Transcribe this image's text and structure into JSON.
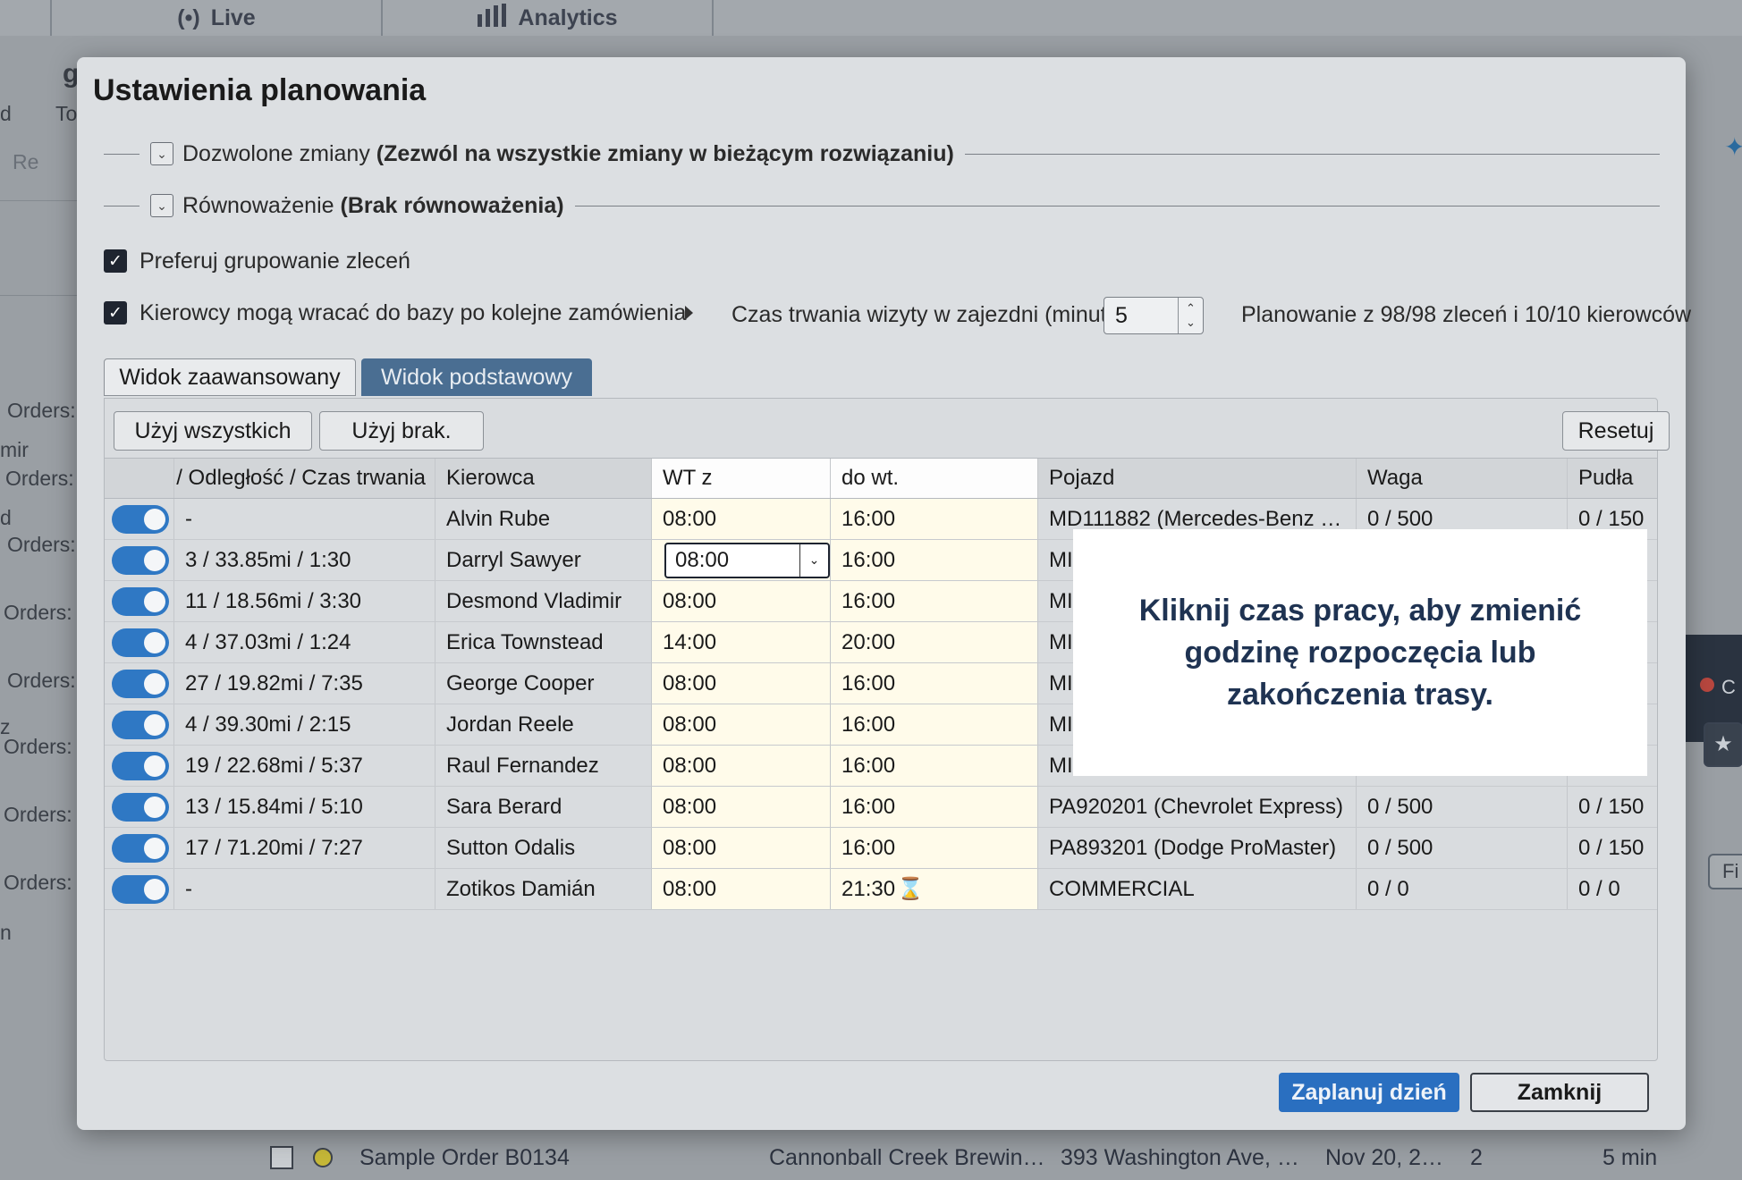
{
  "background": {
    "tabs": [
      {
        "icon": "broadcast-icon",
        "label": "Live"
      },
      {
        "icon": "bar-chart-icon",
        "label": "Analytics"
      }
    ],
    "left_fragments": [
      "g",
      "d",
      "To",
      "Re",
      "Orders:",
      "mir",
      "Orders:",
      "d",
      "Orders:",
      "Orders:",
      "Orders:",
      "z",
      "Orders:",
      "Orders:",
      "Orders:",
      "n"
    ],
    "right_fragments": {
      "c_label": "C",
      "fi_label": "Fi"
    },
    "order_row": {
      "name": "Sample Order B0134",
      "customer": "Cannonball Creek Brewin…",
      "address": "393 Washington Ave, …",
      "date": "Nov 20, 2…",
      "count": "2",
      "duration": "5 min"
    }
  },
  "modal": {
    "title": "Ustawienia planowania",
    "allowed_changes": {
      "label": "Dozwolone zmiany",
      "value": "(Zezwól na wszystkie zmiany w bieżącym rozwiązaniu)"
    },
    "balancing": {
      "label": "Równoważenie",
      "value": "(Brak równoważenia)"
    },
    "prefer_grouping": {
      "label": "Preferuj grupowanie zleceń",
      "checked": true
    },
    "return_to_depot": {
      "label": "Kierowcy mogą wracać do bazy po kolejne zamówienia",
      "checked": true
    },
    "depot_visit": {
      "label": "Czas trwania wizyty w zajezdni (minuty):",
      "value": "5"
    },
    "planning_summary": "Planowanie z 98/98 zleceń i 10/10 kierowców",
    "views": {
      "advanced": "Widok zaawansowany",
      "basic": "Widok podstawowy"
    },
    "toolbar": {
      "use_all": "Użyj wszystkich",
      "use_none": "Użyj brak.",
      "reset": "Resetuj"
    },
    "columns": {
      "distance": "# / Odległość / Czas trwania",
      "driver": "Kierowca",
      "from": "WT z",
      "to": "do wt.",
      "vehicle": "Pojazd",
      "weight": "Waga",
      "boxes": "Pudła"
    },
    "rows": [
      {
        "enabled": true,
        "distance": "-",
        "driver": "Alvin Rube",
        "from": "08:00",
        "to": "16:00",
        "vehicle": "MD111882 (Mercedes-Benz …",
        "weight": "0 / 500",
        "boxes": "0 / 150"
      },
      {
        "enabled": true,
        "distance": "3 / 33.85mi / 1:30",
        "driver": "Darryl Sawyer",
        "from": "08:00",
        "to": "16:00",
        "vehicle": "MI",
        "weight": "",
        "boxes": ""
      },
      {
        "enabled": true,
        "distance": "11 / 18.56mi / 3:30",
        "driver": "Desmond Vladimir",
        "from": "08:00",
        "to": "16:00",
        "vehicle": "MI",
        "weight": "",
        "boxes": ""
      },
      {
        "enabled": true,
        "distance": "4 / 37.03mi / 1:24",
        "driver": "Erica Townstead",
        "from": "14:00",
        "to": "20:00",
        "vehicle": "MI",
        "weight": "",
        "boxes": ""
      },
      {
        "enabled": true,
        "distance": "27 / 19.82mi / 7:35",
        "driver": "George Cooper",
        "from": "08:00",
        "to": "16:00",
        "vehicle": "MI",
        "weight": "",
        "boxes": ""
      },
      {
        "enabled": true,
        "distance": "4 / 39.30mi / 2:15",
        "driver": "Jordan Reele",
        "from": "08:00",
        "to": "16:00",
        "vehicle": "MI",
        "weight": "",
        "boxes": ""
      },
      {
        "enabled": true,
        "distance": "19 / 22.68mi / 5:37",
        "driver": "Raul Fernandez",
        "from": "08:00",
        "to": "16:00",
        "vehicle": "MI",
        "weight": "",
        "boxes": ""
      },
      {
        "enabled": true,
        "distance": "13 / 15.84mi / 5:10",
        "driver": "Sara Berard",
        "from": "08:00",
        "to": "16:00",
        "vehicle": "PA920201 (Chevrolet Express)",
        "weight": "0 / 500",
        "boxes": "0 / 150"
      },
      {
        "enabled": true,
        "distance": "17 / 71.20mi / 7:27",
        "driver": "Sutton Odalis",
        "from": "08:00",
        "to": "16:00",
        "vehicle": "PA893201 (Dodge ProMaster)",
        "weight": "0 / 500",
        "boxes": "0 / 150"
      },
      {
        "enabled": true,
        "distance": "-",
        "driver": "Zotikos Damián",
        "from": "08:00",
        "to": "21:30",
        "to_icon": "hourglass-icon",
        "vehicle": "COMMERCIAL",
        "weight": "0 / 0",
        "boxes": "0 / 0"
      }
    ],
    "editing_row_index": 1,
    "footer": {
      "plan_day": "Zaplanuj dzień",
      "close": "Zamknij"
    }
  },
  "tooltip": {
    "text": "Kliknij czas pracy, aby zmienić godzinę rozpoczęcia lub zakończenia trasy."
  },
  "colors": {
    "accent": "#2a6fc0",
    "toggle_on": "#2f78c4",
    "active_view": "#4a6e92",
    "tooltip_text": "#1f3352",
    "highlight": "#fffbea"
  }
}
